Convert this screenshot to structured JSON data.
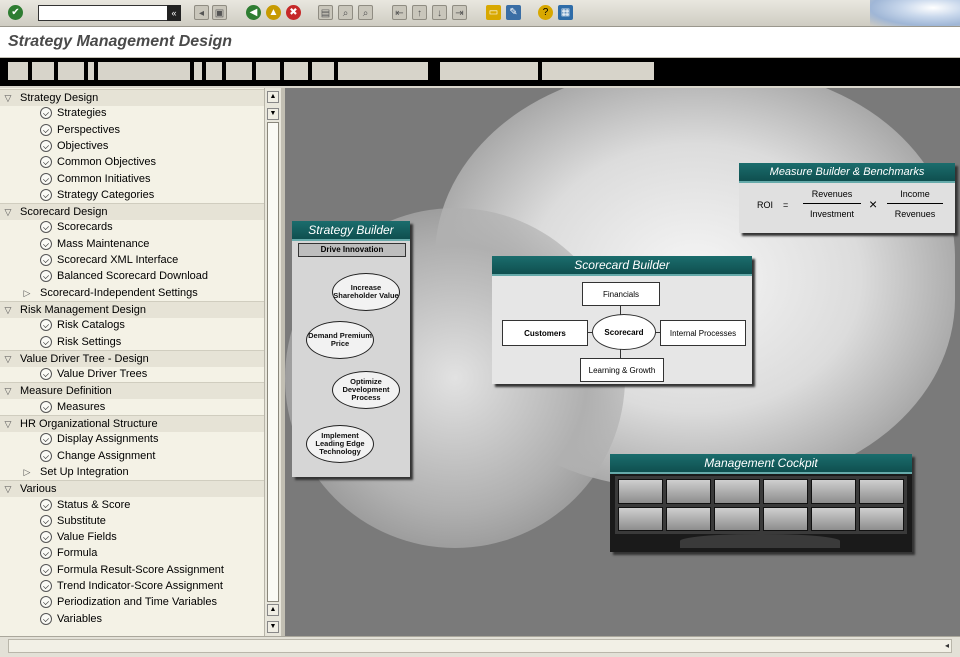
{
  "toolbar": {
    "icons": [
      "enter-icon",
      "command-field",
      "back-icon",
      "exit-icon",
      "cancel-icon",
      "save-icon",
      "print-icon",
      "find-icon",
      "find-next-icon",
      "first-page-icon",
      "prev-page-icon",
      "next-page-icon",
      "last-page-icon",
      "new-session-icon",
      "shortcut-icon",
      "help-icon",
      "layout-icon"
    ]
  },
  "window": {
    "title": "Strategy Management Design"
  },
  "tree": {
    "items": [
      {
        "level": 0,
        "label": "Strategy Design",
        "expanded": true
      },
      {
        "level": 1,
        "label": "Strategies"
      },
      {
        "level": 1,
        "label": "Perspectives"
      },
      {
        "level": 1,
        "label": "Objectives"
      },
      {
        "level": 1,
        "label": "Common Objectives"
      },
      {
        "level": 1,
        "label": "Common Initiatives"
      },
      {
        "level": 1,
        "label": "Strategy Categories"
      },
      {
        "level": 0,
        "label": "Scorecard Design",
        "expanded": true
      },
      {
        "level": 1,
        "label": "Scorecards"
      },
      {
        "level": 1,
        "label": "Mass Maintenance"
      },
      {
        "level": 1,
        "label": "Scorecard XML Interface"
      },
      {
        "level": 1,
        "label": "Balanced Scorecard Download"
      },
      {
        "level": 1,
        "label": "Scorecard-Independent Settings",
        "folder": true
      },
      {
        "level": 0,
        "label": "Risk Management Design",
        "expanded": true
      },
      {
        "level": 1,
        "label": "Risk Catalogs"
      },
      {
        "level": 1,
        "label": "Risk Settings"
      },
      {
        "level": 0,
        "label": "Value Driver Tree - Design",
        "expanded": true
      },
      {
        "level": 1,
        "label": "Value Driver Trees"
      },
      {
        "level": 0,
        "label": "Measure Definition",
        "expanded": true
      },
      {
        "level": 1,
        "label": "Measures"
      },
      {
        "level": 0,
        "label": "HR Organizational Structure",
        "expanded": true
      },
      {
        "level": 1,
        "label": "Display Assignments"
      },
      {
        "level": 1,
        "label": "Change Assignment"
      },
      {
        "level": 1,
        "label": "Set Up Integration",
        "folder": true
      },
      {
        "level": 0,
        "label": "Various",
        "expanded": true
      },
      {
        "level": 1,
        "label": "Status & Score"
      },
      {
        "level": 1,
        "label": "Substitute"
      },
      {
        "level": 1,
        "label": "Value Fields"
      },
      {
        "level": 1,
        "label": "Formula"
      },
      {
        "level": 1,
        "label": "Formula Result-Score Assignment"
      },
      {
        "level": 1,
        "label": "Trend Indicator-Score Assignment"
      },
      {
        "level": 1,
        "label": "Periodization and Time Variables"
      },
      {
        "level": 1,
        "label": "Variables"
      }
    ]
  },
  "content": {
    "strategy_builder": {
      "title": "Strategy Builder",
      "subtitle": "Drive Innovation",
      "steps": [
        "Increase Shareholder Value",
        "Demand Premium Price",
        "Optimize Development Process",
        "Implement Leading Edge Technology"
      ]
    },
    "scorecard_builder": {
      "title": "Scorecard Builder",
      "center": "Scorecard",
      "top": "Financials",
      "left": "Customers",
      "right": "Internal Processes",
      "bottom": "Learning & Growth"
    },
    "measure_builder": {
      "title": "Measure Builder & Benchmarks",
      "roi": "ROI",
      "equals": "=",
      "times": "×",
      "num1": "Revenues",
      "den1": "Investment",
      "num2": "Income",
      "den2": "Revenues"
    },
    "management_cockpit": {
      "title": "Management Cockpit"
    }
  },
  "colors": {
    "card_title": "#0f4f4f",
    "background": "#7a7a7a"
  }
}
